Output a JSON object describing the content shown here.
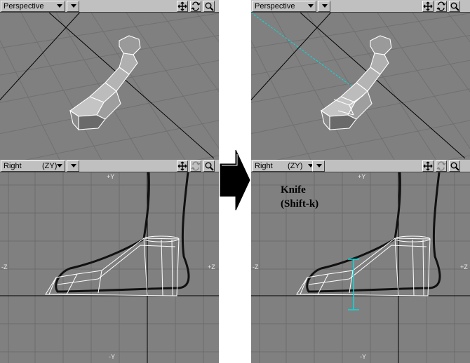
{
  "left_panel": {
    "top_viewport": {
      "view": "Perspective"
    },
    "bottom_viewport": {
      "view": "Right",
      "axis": "(ZY)"
    },
    "axis_labels": {
      "top": "+Y",
      "bottom": "-Y",
      "left": "-Z",
      "right": "+Z"
    }
  },
  "right_panel": {
    "top_viewport": {
      "view": "Perspective"
    },
    "bottom_viewport": {
      "view": "Right",
      "axis": "(ZY)"
    },
    "axis_labels": {
      "top": "+Y",
      "bottom": "-Y",
      "left": "-Z",
      "right": "+Z"
    }
  },
  "annotation": {
    "line1": "Knife",
    "line2": "(Shift-k)"
  },
  "colors": {
    "viewport_bg": "#808080",
    "grid": "#6f6f6f",
    "toolbar_bg": "#c0c0c0",
    "mesh": "#ffffff",
    "knife_tool": "#00e0e0",
    "arrow": "#000000"
  },
  "icons": {
    "move": "move-icon",
    "rotate": "rotate-icon",
    "zoom": "magnifier-icon",
    "view_menu": "chevron-down-icon",
    "transition": "right-arrow-icon"
  }
}
